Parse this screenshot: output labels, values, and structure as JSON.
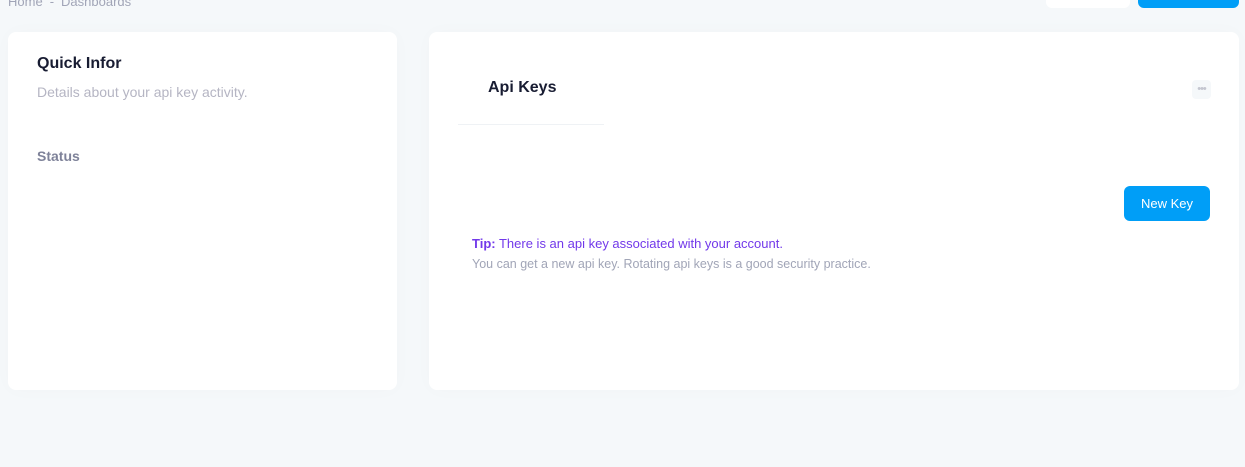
{
  "breadcrumb": {
    "home": "Home",
    "separator": "-",
    "current": "Dashboards"
  },
  "quick_info": {
    "title": "Quick Infor",
    "subtitle": "Details about your api key activity.",
    "status_label": "Status"
  },
  "api_keys": {
    "title": "Api Keys",
    "menu_icon": "more-dots-icon",
    "new_key_button": "New Key",
    "tip_label": "Tip:",
    "tip_text": "There is an api key associated with your account.",
    "tip_subtext": "You can get a new api key. Rotating api keys is a good security practice."
  },
  "colors": {
    "background": "#f5f8fa",
    "primary": "#009ef7",
    "tip": "#7239ea",
    "muted": "#a1a5b7",
    "heading": "#181c32"
  }
}
